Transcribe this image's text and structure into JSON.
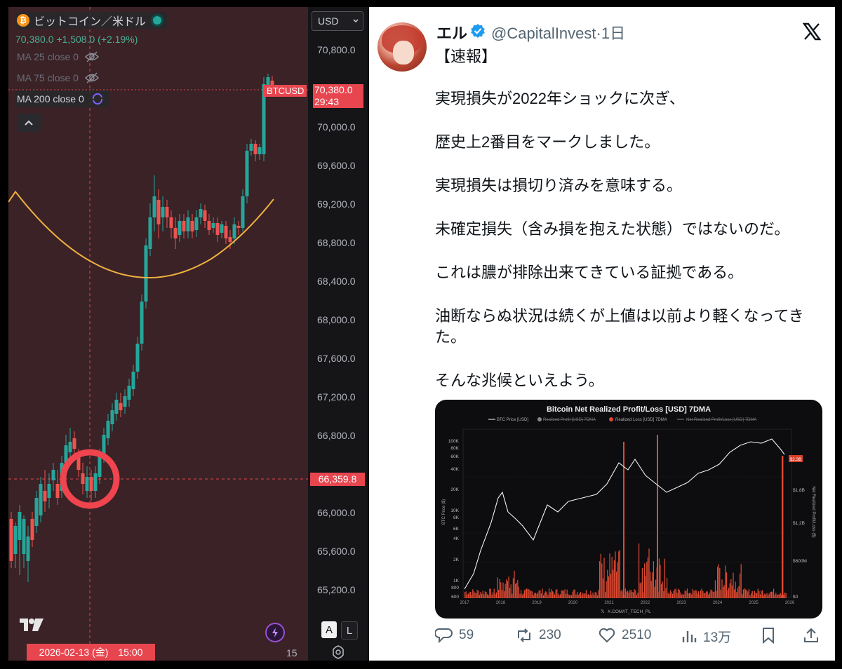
{
  "trading_chart": {
    "title": "ビットコイン／米ドル",
    "coin_icon": "bitcoin-icon",
    "price_summary": "70,380.0 +1,508.0 (+2.19%)",
    "indicators": [
      {
        "label": "MA 25 close 0",
        "visible": false
      },
      {
        "label": "MA 75 close 0",
        "visible": false
      },
      {
        "label": "MA 200 close 0",
        "visible": true
      }
    ],
    "currency": "USD",
    "price_axis": [
      "70,800.0",
      "70,000.0",
      "69,600.0",
      "69,200.0",
      "68,800.0",
      "68,400.0",
      "68,000.0",
      "67,600.0",
      "67,200.0",
      "66,800.0",
      "66,000.0",
      "65,600.0",
      "65,200.0"
    ],
    "symbol_tag": "BTCUSD",
    "last_price": "70,380.0",
    "countdown": "29:43",
    "crosshair_price": "66,359.8",
    "crosshair_date": "2026-02-13 (金)　15:00",
    "next_day_label": "15",
    "scale_buttons": [
      "A",
      "L"
    ],
    "colors": {
      "up": "#26a69a",
      "down": "#ef5350",
      "ma200": "#f0b040",
      "highlight": "#e8464f",
      "background": "#151518"
    }
  },
  "tweet": {
    "display_name": "エル",
    "handle_time": "@CapitalInvest·1日",
    "verified": true,
    "paragraphs": [
      "【速報】",
      "実現損失が2022年ショックに次ぎ、",
      "歴史上2番目をマークしました。",
      "実現損失は損切り済みを意味する。",
      "未確定損失（含み損を抱えた状態）ではないのだ。",
      "これは膿が排除出来てきている証拠である。",
      "油断ならぬ状況は続くが上値は以前より軽くなってきた。",
      "そんな兆候といえよう。"
    ],
    "stats": {
      "replies": "59",
      "reposts": "230",
      "likes": "2510",
      "views": "13万"
    },
    "colors": {
      "name": "#0f1419",
      "secondary": "#536471",
      "verified": "#1d9bf0"
    }
  },
  "embedded_chart": {
    "title": "Bitcoin Net Realized Profit/Loss [USD] 7DMA",
    "legend": [
      "BTC Price [USD]",
      "Realized Profit [USD] 7DMA",
      "Realized Loss [USD] 7DMA",
      "Net Realized Profit/Loss [USD] 7DMA"
    ],
    "left_axis_label": "BTC Price ($)",
    "right_axis_label": "Net Realized Profit/Loss ($)",
    "left_ticks": [
      "100K",
      "80K",
      "60K",
      "40K",
      "20K",
      "10K",
      "8K",
      "6K",
      "4K",
      "2K",
      "1K",
      "800",
      "600"
    ],
    "right_ticks": [
      "$1.8B",
      "$1.2B",
      "$600M",
      "$0"
    ],
    "x_ticks": [
      "2017",
      "2018",
      "2019",
      "2020",
      "2021",
      "2022",
      "2023",
      "2024",
      "2025",
      "2026"
    ],
    "value_badge": "$2.3B",
    "watermark": "X.COM/IT_TECH_PL",
    "colors": {
      "price": "#ffffff",
      "loss": "#e04a32",
      "background": "#0d0d10"
    }
  }
}
